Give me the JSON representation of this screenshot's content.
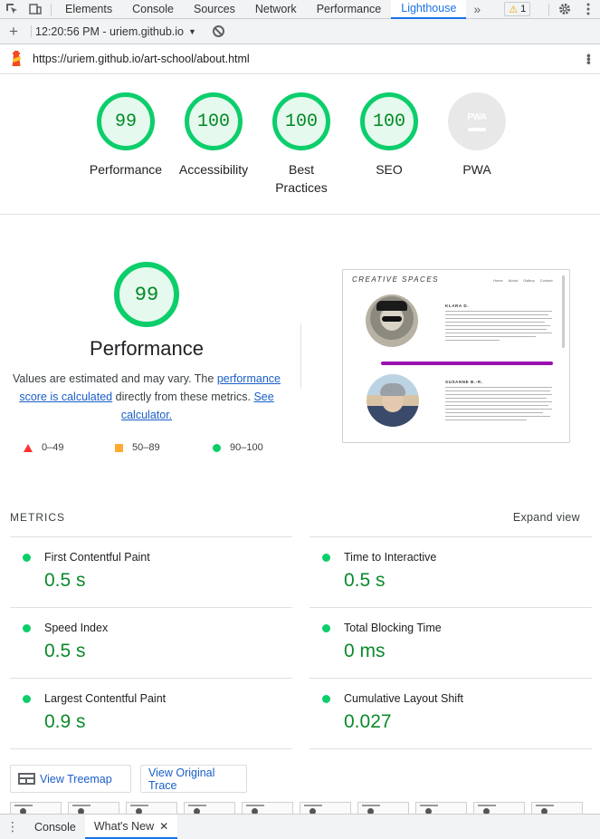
{
  "devtools": {
    "tabs": [
      "Elements",
      "Console",
      "Sources",
      "Network",
      "Performance",
      "Lighthouse"
    ],
    "active_tab": "Lighthouse",
    "warning_count": "1"
  },
  "lighthouse_bar": {
    "report_label": "12:20:56 PM - uriem.github.io"
  },
  "url": "https://uriem.github.io/art-school/about.html",
  "categories": [
    {
      "label": "Performance",
      "score": "99"
    },
    {
      "label": "Accessibility",
      "score": "100"
    },
    {
      "label": "Best Practices",
      "score": "100"
    },
    {
      "label": "SEO",
      "score": "100"
    },
    {
      "label": "PWA",
      "score": ""
    }
  ],
  "pwa_badge": "PWA",
  "performance": {
    "score": "99",
    "title": "Performance",
    "desc_1": "Values are estimated and may vary. The ",
    "desc_link_1": "performance score is calculated",
    "desc_2": " directly from these metrics. ",
    "desc_link_2": "See calculator.",
    "legend": [
      "0–49",
      "50–89",
      "90–100"
    ]
  },
  "screenshot": {
    "brand": "CREATIVE SPACES",
    "nav": [
      "Home",
      "About",
      "Gallery",
      "Contact"
    ],
    "person1": "KLARA D.",
    "person2": "SUSANNE B.-R."
  },
  "metrics": {
    "heading": "METRICS",
    "expand_label": "Expand view",
    "items": [
      {
        "name": "First Contentful Paint",
        "value": "0.5 s"
      },
      {
        "name": "Time to Interactive",
        "value": "0.5 s"
      },
      {
        "name": "Speed Index",
        "value": "0.5 s"
      },
      {
        "name": "Total Blocking Time",
        "value": "0 ms"
      },
      {
        "name": "Largest Contentful Paint",
        "value": "0.9 s"
      },
      {
        "name": "Cumulative Layout Shift",
        "value": "0.027"
      }
    ]
  },
  "buttons": {
    "treemap": "View Treemap",
    "trace": "View Original Trace"
  },
  "drawer": {
    "tabs": [
      "Console",
      "What's New"
    ],
    "active": "What's New"
  },
  "colors": {
    "pass": "#0cce6b",
    "pass_text": "#008a24",
    "average": "#ffaa33",
    "fail": "#ff3333",
    "accent": "#1a73e8"
  }
}
